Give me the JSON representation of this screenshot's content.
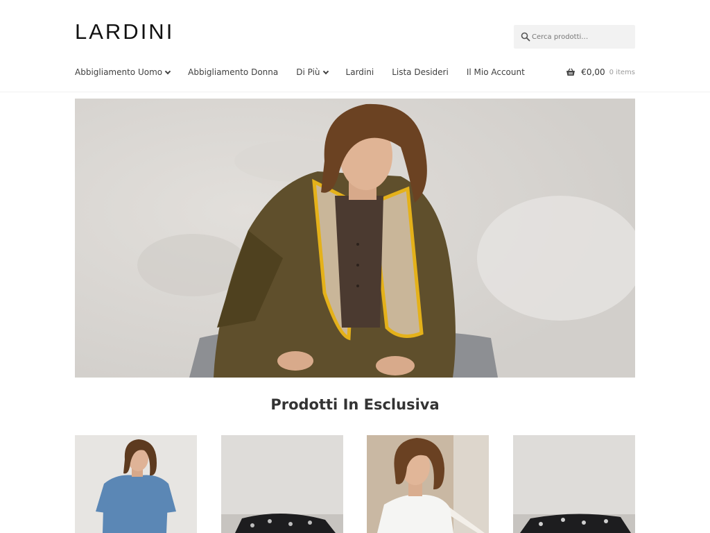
{
  "header": {
    "logo": "LARDINI",
    "search_placeholder": "Cerca prodotti…"
  },
  "nav": {
    "items": [
      {
        "label": "Abbigliamento Uomo",
        "has_dropdown": true
      },
      {
        "label": "Abbigliamento Donna",
        "has_dropdown": false
      },
      {
        "label": "Di Più",
        "has_dropdown": true
      },
      {
        "label": "Lardini",
        "has_dropdown": false
      },
      {
        "label": "Lista Desideri",
        "has_dropdown": false
      },
      {
        "label": "Il Mio Account",
        "has_dropdown": false
      }
    ]
  },
  "cart": {
    "amount": "€0,00",
    "count": "0 items",
    "icon": "basket-icon"
  },
  "section": {
    "title": "Prodotti In Esclusiva"
  },
  "colors": {
    "text": "#43454b",
    "search_bg": "#f2f2f2",
    "accent_yellow": "#e4b11a"
  }
}
